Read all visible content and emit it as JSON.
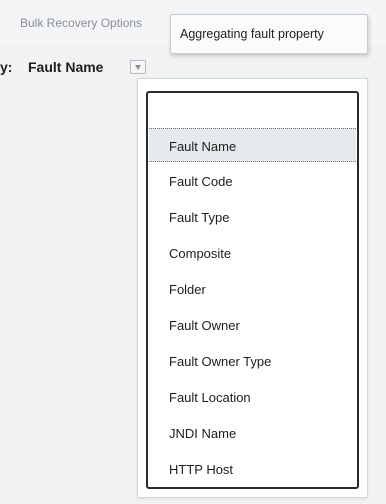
{
  "header": {
    "bulk_recovery_label": "Bulk Recovery Options"
  },
  "group_by": {
    "prefix": "y:",
    "value": "Fault Name",
    "dropdown_icon": "triangle-down-icon"
  },
  "tooltip": {
    "text": "Aggregating fault property"
  },
  "dropdown": {
    "empty_option": "",
    "selected_index": 0,
    "options": [
      "Fault Name",
      "Fault Code",
      "Fault Type",
      "Composite",
      "Folder",
      "Fault Owner",
      "Fault Owner Type",
      "Fault Location",
      "JNDI Name",
      "HTTP Host"
    ]
  }
}
